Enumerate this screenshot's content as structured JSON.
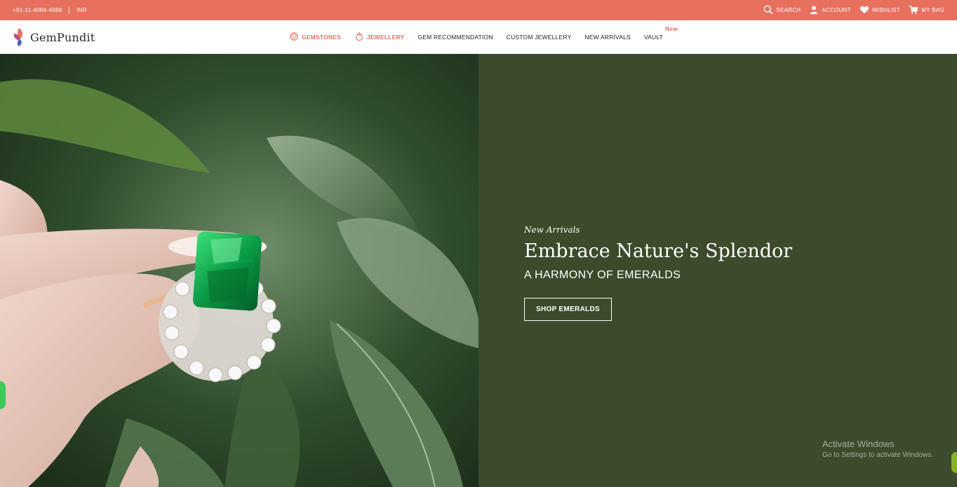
{
  "topbar": {
    "phone": "+91-11-4084-4599",
    "currency": "INR",
    "search_label": "SEARCH",
    "account_label": "ACCOUNT",
    "wishlist_label": "WISHLIST",
    "bag_label": "MY BAG"
  },
  "navbar": {
    "logo_text": "GemPundit",
    "links": [
      {
        "label": "GEMSTONES",
        "icon": "gem-icon"
      },
      {
        "label": "JEWELLERY",
        "icon": "ring-icon"
      },
      {
        "label": "GEM RECOMMENDATION"
      },
      {
        "label": "CUSTOM JEWELLERY"
      },
      {
        "label": "NEW ARRIVALS"
      },
      {
        "label": "VAULT",
        "badge": "New"
      }
    ]
  },
  "hero": {
    "kicker": "New Arrivals",
    "title": "Embrace Nature's Splendor",
    "subtitle": "A HARMONY OF EMERALDS",
    "button_label": "SHOP EMERALDS"
  },
  "watermark": {
    "title": "Activate Windows",
    "subtitle": "Go to Settings to activate Windows."
  },
  "colors": {
    "accent": "#e8705f",
    "hero_panel": "#3b4b2b"
  }
}
